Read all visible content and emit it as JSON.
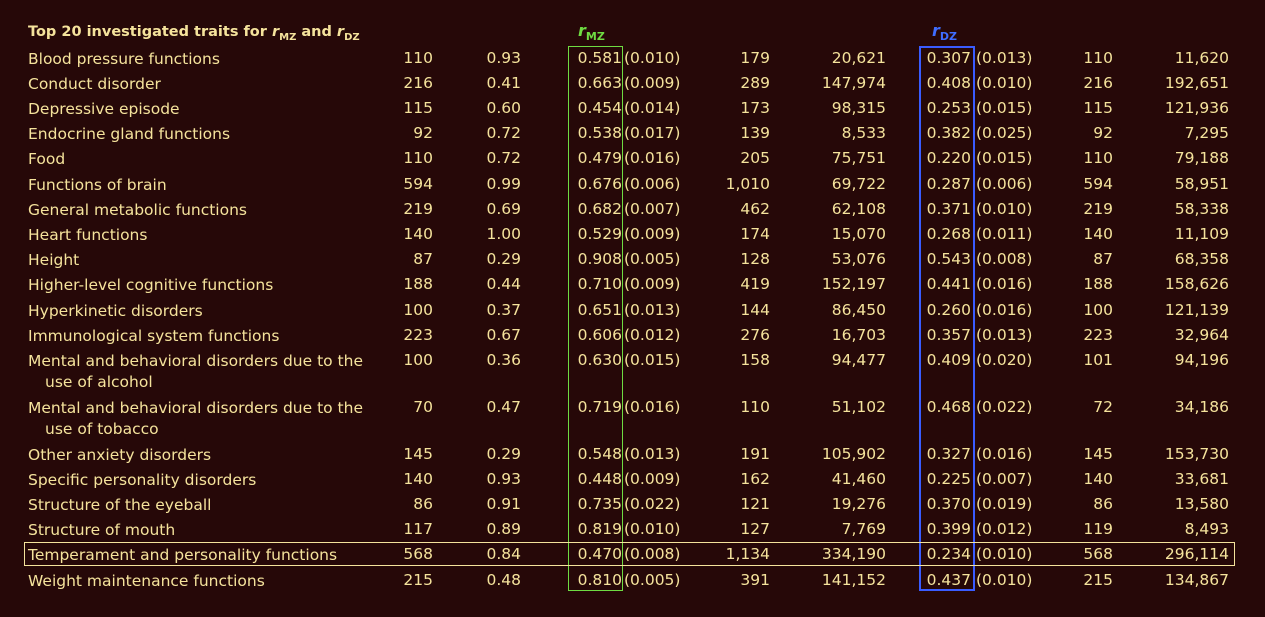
{
  "title": {
    "prefix": "Top 20 investigated traits for ",
    "r1": "r",
    "r1_sub": "MZ",
    "joiner": " and ",
    "r2": "r",
    "r2_sub": "DZ"
  },
  "column_headers": {
    "rmz": {
      "r": "r",
      "sub": "MZ"
    },
    "rdz": {
      "r": "r",
      "sub": "DZ"
    }
  },
  "colors": {
    "background": "#260808",
    "text": "#f5e39c",
    "rmz_accent": "#6fdc42",
    "rdz_accent": "#3a5cff",
    "highlight_border": "#f5e39c"
  },
  "highlighted_row": "Temperament and personality functions",
  "rows": [
    {
      "trait": "Blood pressure functions",
      "n1": "110",
      "p": "0.93",
      "rmz": "0.581",
      "rmz_se": "(0.010)",
      "pairs": "179",
      "n2": "20,621",
      "rdz": "0.307",
      "rdz_se": "(0.013)",
      "n3": "110",
      "n4": "11,620"
    },
    {
      "trait": "Conduct disorder",
      "n1": "216",
      "p": "0.41",
      "rmz": "0.663",
      "rmz_se": "(0.009)",
      "pairs": "289",
      "n2": "147,974",
      "rdz": "0.408",
      "rdz_se": "(0.010)",
      "n3": "216",
      "n4": "192,651"
    },
    {
      "trait": "Depressive episode",
      "n1": "115",
      "p": "0.60",
      "rmz": "0.454",
      "rmz_se": "(0.014)",
      "pairs": "173",
      "n2": "98,315",
      "rdz": "0.253",
      "rdz_se": "(0.015)",
      "n3": "115",
      "n4": "121,936"
    },
    {
      "trait": "Endocrine gland functions",
      "n1": "92",
      "p": "0.72",
      "rmz": "0.538",
      "rmz_se": "(0.017)",
      "pairs": "139",
      "n2": "8,533",
      "rdz": "0.382",
      "rdz_se": "(0.025)",
      "n3": "92",
      "n4": "7,295"
    },
    {
      "trait": "Food",
      "n1": "110",
      "p": "0.72",
      "rmz": "0.479",
      "rmz_se": "(0.016)",
      "pairs": "205",
      "n2": "75,751",
      "rdz": "0.220",
      "rdz_se": "(0.015)",
      "n3": "110",
      "n4": "79,188"
    },
    {
      "trait": "Functions of brain",
      "n1": "594",
      "p": "0.99",
      "rmz": "0.676",
      "rmz_se": "(0.006)",
      "pairs": "1,010",
      "n2": "69,722",
      "rdz": "0.287",
      "rdz_se": "(0.006)",
      "n3": "594",
      "n4": "58,951"
    },
    {
      "trait": "General metabolic functions",
      "n1": "219",
      "p": "0.69",
      "rmz": "0.682",
      "rmz_se": "(0.007)",
      "pairs": "462",
      "n2": "62,108",
      "rdz": "0.371",
      "rdz_se": "(0.010)",
      "n3": "219",
      "n4": "58,338"
    },
    {
      "trait": "Heart functions",
      "n1": "140",
      "p": "1.00",
      "rmz": "0.529",
      "rmz_se": "(0.009)",
      "pairs": "174",
      "n2": "15,070",
      "rdz": "0.268",
      "rdz_se": "(0.011)",
      "n3": "140",
      "n4": "11,109"
    },
    {
      "trait": "Height",
      "n1": "87",
      "p": "0.29",
      "rmz": "0.908",
      "rmz_se": "(0.005)",
      "pairs": "128",
      "n2": "53,076",
      "rdz": "0.543",
      "rdz_se": "(0.008)",
      "n3": "87",
      "n4": "68,358"
    },
    {
      "trait": "Higher-level cognitive functions",
      "n1": "188",
      "p": "0.44",
      "rmz": "0.710",
      "rmz_se": "(0.009)",
      "pairs": "419",
      "n2": "152,197",
      "rdz": "0.441",
      "rdz_se": "(0.016)",
      "n3": "188",
      "n4": "158,626"
    },
    {
      "trait": "Hyperkinetic disorders",
      "n1": "100",
      "p": "0.37",
      "rmz": "0.651",
      "rmz_se": "(0.013)",
      "pairs": "144",
      "n2": "86,450",
      "rdz": "0.260",
      "rdz_se": "(0.016)",
      "n3": "100",
      "n4": "121,139"
    },
    {
      "trait": "Immunological system functions",
      "n1": "223",
      "p": "0.67",
      "rmz": "0.606",
      "rmz_se": "(0.012)",
      "pairs": "276",
      "n2": "16,703",
      "rdz": "0.357",
      "rdz_se": "(0.013)",
      "n3": "223",
      "n4": "32,964"
    },
    {
      "trait": "Mental and behavioral disorders due to the use of alcohol",
      "n1": "100",
      "p": "0.36",
      "rmz": "0.630",
      "rmz_se": "(0.015)",
      "pairs": "158",
      "n2": "94,477",
      "rdz": "0.409",
      "rdz_se": "(0.020)",
      "n3": "101",
      "n4": "94,196"
    },
    {
      "trait": "Mental and behavioral disorders due to the use of tobacco",
      "n1": "70",
      "p": "0.47",
      "rmz": "0.719",
      "rmz_se": "(0.016)",
      "pairs": "110",
      "n2": "51,102",
      "rdz": "0.468",
      "rdz_se": "(0.022)",
      "n3": "72",
      "n4": "34,186"
    },
    {
      "trait": "Other anxiety disorders",
      "n1": "145",
      "p": "0.29",
      "rmz": "0.548",
      "rmz_se": "(0.013)",
      "pairs": "191",
      "n2": "105,902",
      "rdz": "0.327",
      "rdz_se": "(0.016)",
      "n3": "145",
      "n4": "153,730"
    },
    {
      "trait": "Specific personality disorders",
      "n1": "140",
      "p": "0.93",
      "rmz": "0.448",
      "rmz_se": "(0.009)",
      "pairs": "162",
      "n2": "41,460",
      "rdz": "0.225",
      "rdz_se": "(0.007)",
      "n3": "140",
      "n4": "33,681"
    },
    {
      "trait": "Structure of the eyeball",
      "n1": "86",
      "p": "0.91",
      "rmz": "0.735",
      "rmz_se": "(0.022)",
      "pairs": "121",
      "n2": "19,276",
      "rdz": "0.370",
      "rdz_se": "(0.019)",
      "n3": "86",
      "n4": "13,580"
    },
    {
      "trait": "Structure of mouth",
      "n1": "117",
      "p": "0.89",
      "rmz": "0.819",
      "rmz_se": "(0.010)",
      "pairs": "127",
      "n2": "7,769",
      "rdz": "0.399",
      "rdz_se": "(0.012)",
      "n3": "119",
      "n4": "8,493"
    },
    {
      "trait": "Temperament and personality functions",
      "n1": "568",
      "p": "0.84",
      "rmz": "0.470",
      "rmz_se": "(0.008)",
      "pairs": "1,134",
      "n2": "334,190",
      "rdz": "0.234",
      "rdz_se": "(0.010)",
      "n3": "568",
      "n4": "296,114"
    },
    {
      "trait": "Weight maintenance functions",
      "n1": "215",
      "p": "0.48",
      "rmz": "0.810",
      "rmz_se": "(0.005)",
      "pairs": "391",
      "n2": "141,152",
      "rdz": "0.437",
      "rdz_se": "(0.010)",
      "n3": "215",
      "n4": "134,867"
    }
  ]
}
